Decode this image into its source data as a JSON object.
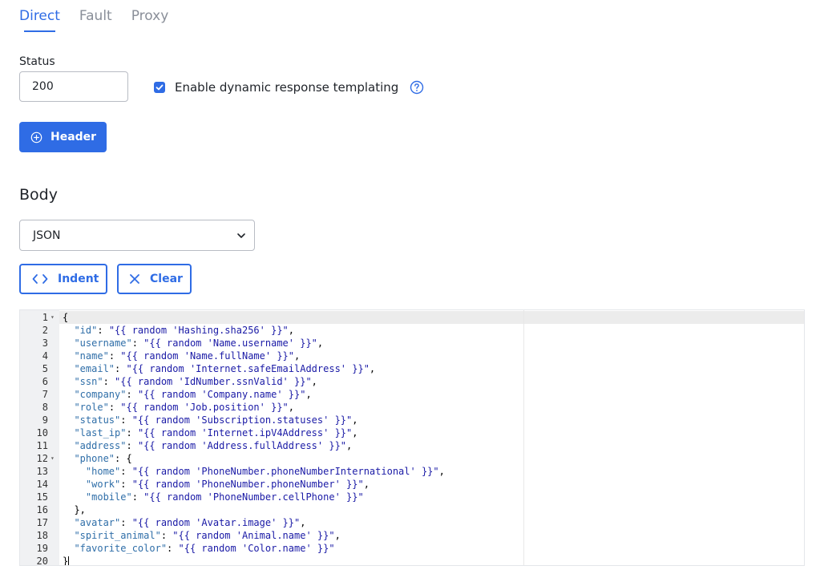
{
  "tabs": [
    {
      "label": "Direct",
      "active": true
    },
    {
      "label": "Fault",
      "active": false
    },
    {
      "label": "Proxy",
      "active": false
    }
  ],
  "status": {
    "label": "Status",
    "value": "200"
  },
  "templating": {
    "label": "Enable dynamic response templating",
    "checked": true
  },
  "header_button": {
    "label": "Header"
  },
  "body": {
    "title": "Body",
    "format_select": {
      "value": "JSON"
    },
    "indent_button": {
      "label": "Indent"
    },
    "clear_button": {
      "label": "Clear"
    }
  },
  "editor": {
    "lines": [
      {
        "n": "1",
        "fold": true,
        "text": "{"
      },
      {
        "n": "2",
        "key": "id",
        "value": "{{ random 'Hashing.sha256' }}",
        "indent": 1,
        "comma": true
      },
      {
        "n": "3",
        "key": "username",
        "value": "{{ random 'Name.username' }}",
        "indent": 1,
        "comma": true
      },
      {
        "n": "4",
        "key": "name",
        "value": "{{ random 'Name.fullName' }}",
        "indent": 1,
        "comma": true
      },
      {
        "n": "5",
        "key": "email",
        "value": "{{ random 'Internet.safeEmailAddress' }}",
        "indent": 1,
        "comma": true
      },
      {
        "n": "6",
        "key": "ssn",
        "value": "{{ random 'IdNumber.ssnValid' }}",
        "indent": 1,
        "comma": true
      },
      {
        "n": "7",
        "key": "company",
        "value": "{{ random 'Company.name' }}",
        "indent": 1,
        "comma": true
      },
      {
        "n": "8",
        "key": "role",
        "value": "{{ random 'Job.position' }}",
        "indent": 1,
        "comma": true
      },
      {
        "n": "9",
        "key": "status",
        "value": "{{ random 'Subscription.statuses' }}",
        "indent": 1,
        "comma": true
      },
      {
        "n": "10",
        "key": "last_ip",
        "value": "{{ random 'Internet.ipV4Address' }}",
        "indent": 1,
        "comma": true
      },
      {
        "n": "11",
        "key": "address",
        "value": "{{ random 'Address.fullAddress' }}",
        "indent": 1,
        "comma": true
      },
      {
        "n": "12",
        "fold": true,
        "key": "phone",
        "open": "{",
        "indent": 1
      },
      {
        "n": "13",
        "key": "home",
        "value": "{{ random 'PhoneNumber.phoneNumberInternational' }}",
        "indent": 2,
        "comma": true
      },
      {
        "n": "14",
        "key": "work",
        "value": "{{ random 'PhoneNumber.phoneNumber' }}",
        "indent": 2,
        "comma": true
      },
      {
        "n": "15",
        "key": "mobile",
        "value": "{{ random 'PhoneNumber.cellPhone' }}",
        "indent": 2,
        "comma": false
      },
      {
        "n": "16",
        "text": "},",
        "indent": 1
      },
      {
        "n": "17",
        "key": "avatar",
        "value": "{{ random 'Avatar.image' }}",
        "indent": 1,
        "comma": true
      },
      {
        "n": "18",
        "key": "spirit_animal",
        "value": "{{ random 'Animal.name' }}",
        "indent": 1,
        "comma": true
      },
      {
        "n": "19",
        "key": "favorite_color",
        "value": "{{ random 'Color.name' }}",
        "indent": 1,
        "comma": false
      },
      {
        "n": "20",
        "text": "}"
      }
    ]
  },
  "colors": {
    "accent": "#2f6ce5",
    "json_key": "#2f6ea8",
    "json_string": "#1a1aa6"
  }
}
